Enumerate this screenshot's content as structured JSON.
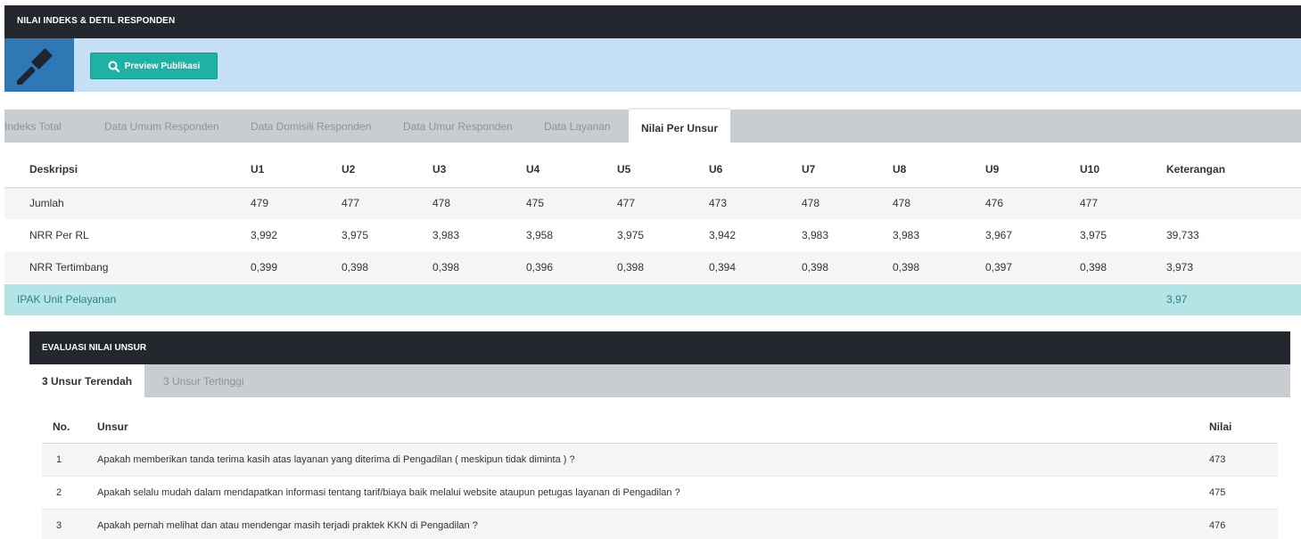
{
  "header": {
    "title": "NILAI INDEKS & DETIL RESPONDEN"
  },
  "toolbar": {
    "logo_icon": "gavel-icon",
    "preview_icon": "search-icon",
    "preview_label": "Preview Publikasi"
  },
  "tabs": [
    {
      "label": "Indeks Total",
      "active": false
    },
    {
      "label": "Data Umum Responden",
      "active": false
    },
    {
      "label": "Data Domisili Responden",
      "active": false
    },
    {
      "label": "Data Umur Responden",
      "active": false
    },
    {
      "label": "Data Layanan",
      "active": false
    },
    {
      "label": "Nilai Per Unsur",
      "active": true
    }
  ],
  "table": {
    "headers": [
      "Deskripsi",
      "U1",
      "U2",
      "U3",
      "U4",
      "U5",
      "U6",
      "U7",
      "U8",
      "U9",
      "U10",
      "Keterangan"
    ],
    "rows": [
      [
        "Jumlah",
        "479",
        "477",
        "478",
        "475",
        "477",
        "473",
        "478",
        "478",
        "476",
        "477",
        ""
      ],
      [
        "NRR Per RL",
        "3,992",
        "3,975",
        "3,983",
        "3,958",
        "3,975",
        "3,942",
        "3,983",
        "3,983",
        "3,967",
        "3,975",
        "39,733"
      ],
      [
        "NRR Tertimbang",
        "0,399",
        "0,398",
        "0,398",
        "0,396",
        "0,398",
        "0,394",
        "0,398",
        "0,398",
        "0,397",
        "0,398",
        "3,973"
      ]
    ],
    "ipak": {
      "label": "IPAK Unit Pelayanan",
      "value": "3,97"
    }
  },
  "evaluasi": {
    "title": "EVALUASI NILAI UNSUR",
    "tabs": [
      {
        "label": "3 Unsur Terendah",
        "active": true
      },
      {
        "label": "3 Unsur Tertinggi",
        "active": false
      }
    ],
    "headers": {
      "no": "No.",
      "unsur": "Unsur",
      "nilai": "Nilai"
    },
    "rows": [
      {
        "no": "1",
        "unsur": "Apakah memberikan tanda terima kasih atas layanan yang diterima di Pengadilan ( meskipun tidak diminta ) ?",
        "nilai": "473"
      },
      {
        "no": "2",
        "unsur": "Apakah selalu mudah dalam mendapatkan informasi tentang tarif/biaya baik melalui website ataupun petugas layanan di Pengadilan ?",
        "nilai": "475"
      },
      {
        "no": "3",
        "unsur": "Apakah pernah melihat dan atau mendengar masih terjadi praktek KKN di Pengadilan ?",
        "nilai": "476"
      }
    ]
  }
}
